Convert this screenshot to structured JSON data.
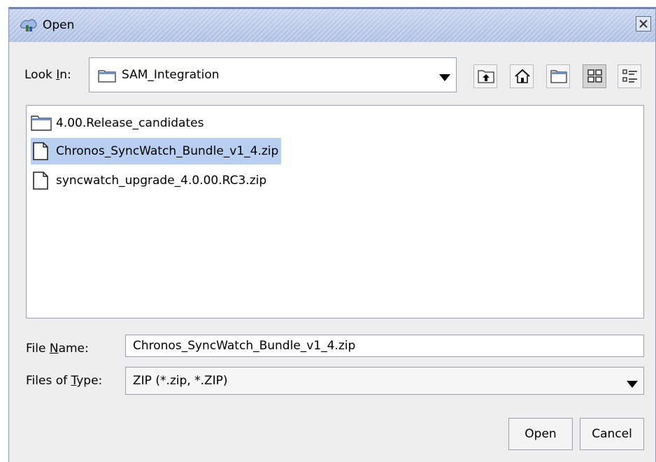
{
  "window": {
    "title": "Open"
  },
  "look_in": {
    "label_before": "Look ",
    "label_mnemonic": "I",
    "label_after": "n:",
    "value": "SAM_Integration"
  },
  "toolbar": {
    "icons": [
      "up-one-level-icon",
      "home-icon",
      "new-folder-icon",
      "list-view-icon",
      "details-view-icon"
    ]
  },
  "files": [
    {
      "name": "4.00.Release_candidates",
      "type": "folder"
    },
    {
      "name": "Chronos_SyncWatch_Bundle_v1_4.zip",
      "type": "file",
      "selected": true
    },
    {
      "name": "syncwatch_upgrade_4.0.00.RC3.zip",
      "type": "file"
    }
  ],
  "file_name": {
    "label_before": "File ",
    "label_mnemonic": "N",
    "label_after": "ame:",
    "value": "Chronos_SyncWatch_Bundle_v1_4.zip"
  },
  "file_type": {
    "label_before": "Files of ",
    "label_mnemonic": "T",
    "label_after": "ype:",
    "value": "ZIP (*.zip, *.ZIP)"
  },
  "buttons": {
    "open": "Open",
    "cancel": "Cancel"
  },
  "colors": {
    "titlebar": "#aebfe2",
    "selection": "#b8cff0",
    "background": "#eeeeee"
  }
}
